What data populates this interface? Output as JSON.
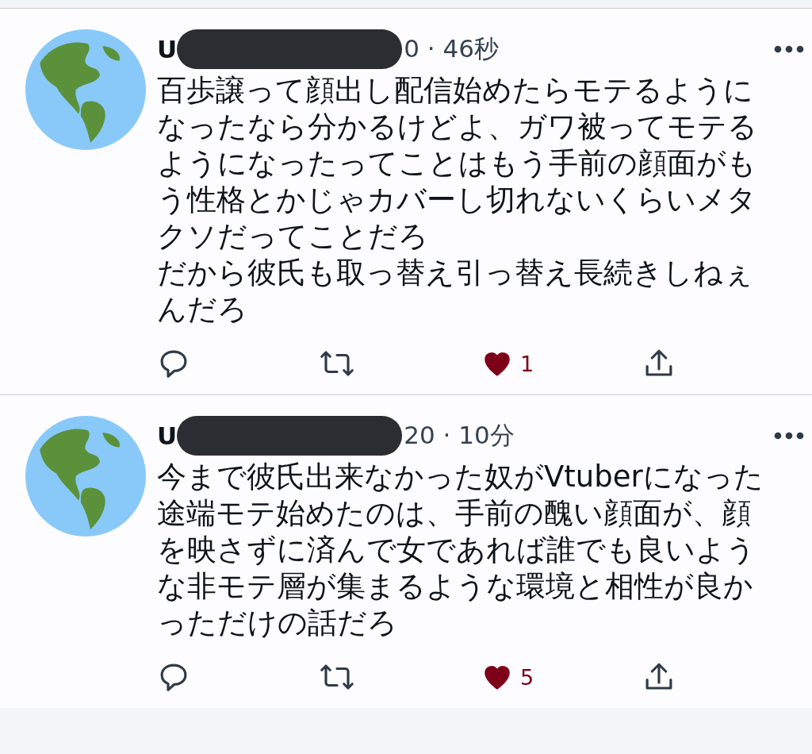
{
  "tweets": [
    {
      "name": "U",
      "time": "0 · 46秒",
      "redacted": true,
      "paragraphs": [
        "百歩譲って顔出し配信始めたらモテるようになったなら分かるけどよ、ガワ被ってモテるようになったってことはもう手前の顔面がもう性格とかじゃカバーし切れないくらいメタクソだってことだろ",
        "だから彼氏も取っ替え引っ替え長続きしねぇんだろ"
      ],
      "liked": true,
      "like_count": "1"
    },
    {
      "name": "U",
      "time": "20 · 10分",
      "redacted": true,
      "paragraphs": [
        "今まで彼氏出来なかった奴がVtuberになった途端モテ始めたのは、手前の醜い顔面が、顔を映さずに済んで女であれば誰でも良いような非モテ層が集まるような環境と相性が良かっただけの話だろ"
      ],
      "liked": true,
      "like_count": "5"
    }
  ]
}
